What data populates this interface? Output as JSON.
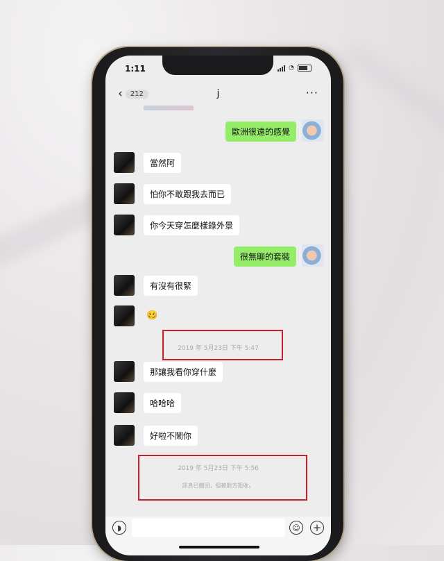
{
  "status": {
    "time": "1:11"
  },
  "nav": {
    "back_count": "212",
    "title": "j",
    "more": "···"
  },
  "messages": [
    {
      "side": "right",
      "text": "歐洲很遠的感覺"
    },
    {
      "side": "left",
      "text": "當然阿"
    },
    {
      "side": "left",
      "text": "怕你不敢跟我去而已"
    },
    {
      "side": "left",
      "text": "你今天穿怎麼樣錄外景"
    },
    {
      "side": "right",
      "text": "很無聊的套裝"
    },
    {
      "side": "left",
      "text": "有沒有很緊"
    },
    {
      "side": "left",
      "text": "🥴"
    },
    {
      "side": "left",
      "text": "那讓我看你穿什麼"
    },
    {
      "side": "left",
      "text": "哈哈哈"
    },
    {
      "side": "left",
      "text": "好啦不鬧你"
    }
  ],
  "timestamps": {
    "first": "2019 年 5月23日 下午 5:47",
    "second": "2019 年 5月23日 下午 5:56"
  },
  "notice": "訊息已撤回，但被對方拒收。",
  "colors": {
    "sent_bubble": "#95ec69",
    "received_bubble": "#ffffff",
    "highlight_box": "#c8202a"
  }
}
